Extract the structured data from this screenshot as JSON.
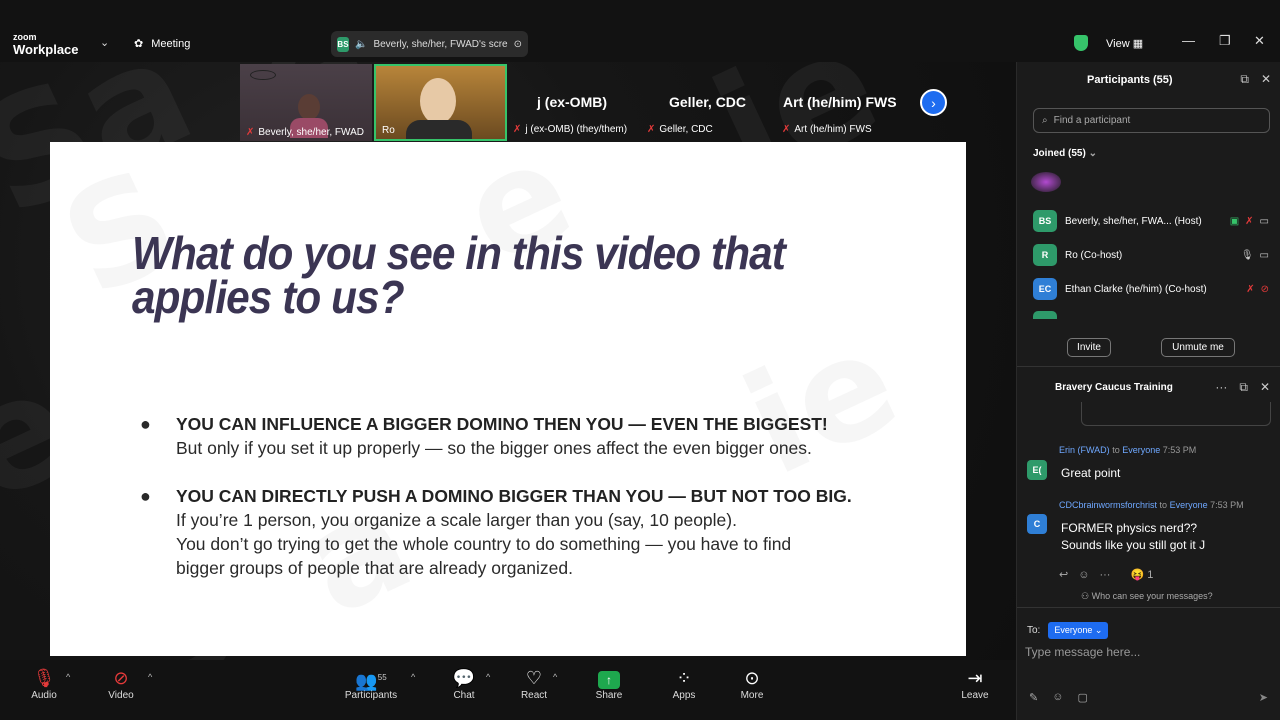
{
  "app": {
    "logo_small": "zoom",
    "logo_large": "Workplace",
    "meeting_label": "Meeting",
    "share_status": "Beverly, she/her, FWAD's scre",
    "view_label": "View"
  },
  "video_strip": [
    {
      "name": "Beverly, she/her, FWAD",
      "has_video": true
    },
    {
      "name": "Ro",
      "has_video": true
    },
    {
      "title": "j (ex-OMB)",
      "name": "j (ex-OMB) (they/them)"
    },
    {
      "title": "Geller, CDC",
      "name": "Geller, CDC"
    },
    {
      "title": "Art (he/him) FWS",
      "name": "Art (he/him) FWS"
    }
  ],
  "slide": {
    "title_line1": "What do you see in this video that",
    "title_line2": "applies to us?",
    "bullets": [
      {
        "heading": "YOU CAN INFLUENCE A BIGGER DOMINO THEN YOU — EVEN THE BIGGEST!",
        "lines": [
          "But only if you set it up properly — so the bigger ones affect the even bigger ones."
        ]
      },
      {
        "heading": "YOU CAN DIRECTLY PUSH A DOMINO BIGGER THAN YOU — BUT NOT TOO BIG.",
        "lines": [
          "If you’re 1 person, you organize a scale larger than you (say, 10 people).",
          "You don’t go trying to get the whole country to do something — you have to find",
          "bigger groups of people that are already organized."
        ]
      }
    ]
  },
  "toolbar": {
    "audio": "Audio",
    "video": "Video",
    "participants": "Participants",
    "participants_count": "55",
    "chat": "Chat",
    "react": "React",
    "share": "Share",
    "apps": "Apps",
    "more": "More",
    "leave": "Leave"
  },
  "participants_panel": {
    "title": "Participants (55)",
    "search_placeholder": "Find a participant",
    "joined_label": "Joined (55)",
    "rows": [
      {
        "initials": "BS",
        "name": "Beverly, she/her, FWA... (Host)",
        "color": "#2e9a6a"
      },
      {
        "initials": "R",
        "name": "Ro (Co-host)",
        "color": "#2e9a6a"
      },
      {
        "initials": "EC",
        "name": "Ethan Clarke (he/him) (Co-host)",
        "color": "#2f7fd6"
      }
    ],
    "invite": "Invite",
    "unmute_me": "Unmute me"
  },
  "chat_panel": {
    "title": "Bravery Caucus Training",
    "messages": [
      {
        "initials": "E(",
        "sender": "Erin (FWAD)",
        "to_word": "to",
        "recipient": "Everyone",
        "time": "7:53 PM",
        "lines": [
          "Great point"
        ],
        "color": "#2e9a6a"
      },
      {
        "initials": "C",
        "sender": "CDCbrainwormsforchrist",
        "to_word": "to",
        "recipient": "Everyone",
        "time": "7:53 PM",
        "lines": [
          "FORMER physics nerd??",
          "Sounds like you still got it J"
        ],
        "color": "#2f7fd6"
      }
    ],
    "reaction_count": "1",
    "who_can_see": "Who can see your messages?",
    "to_label": "To:",
    "to_value": "Everyone",
    "input_placeholder": "Type message here..."
  },
  "colors": {
    "accent": "#1e6cf0",
    "slide_title": "#3b3553",
    "active_speaker_border": "#36c46a",
    "mute_red": "#e53a3a"
  }
}
